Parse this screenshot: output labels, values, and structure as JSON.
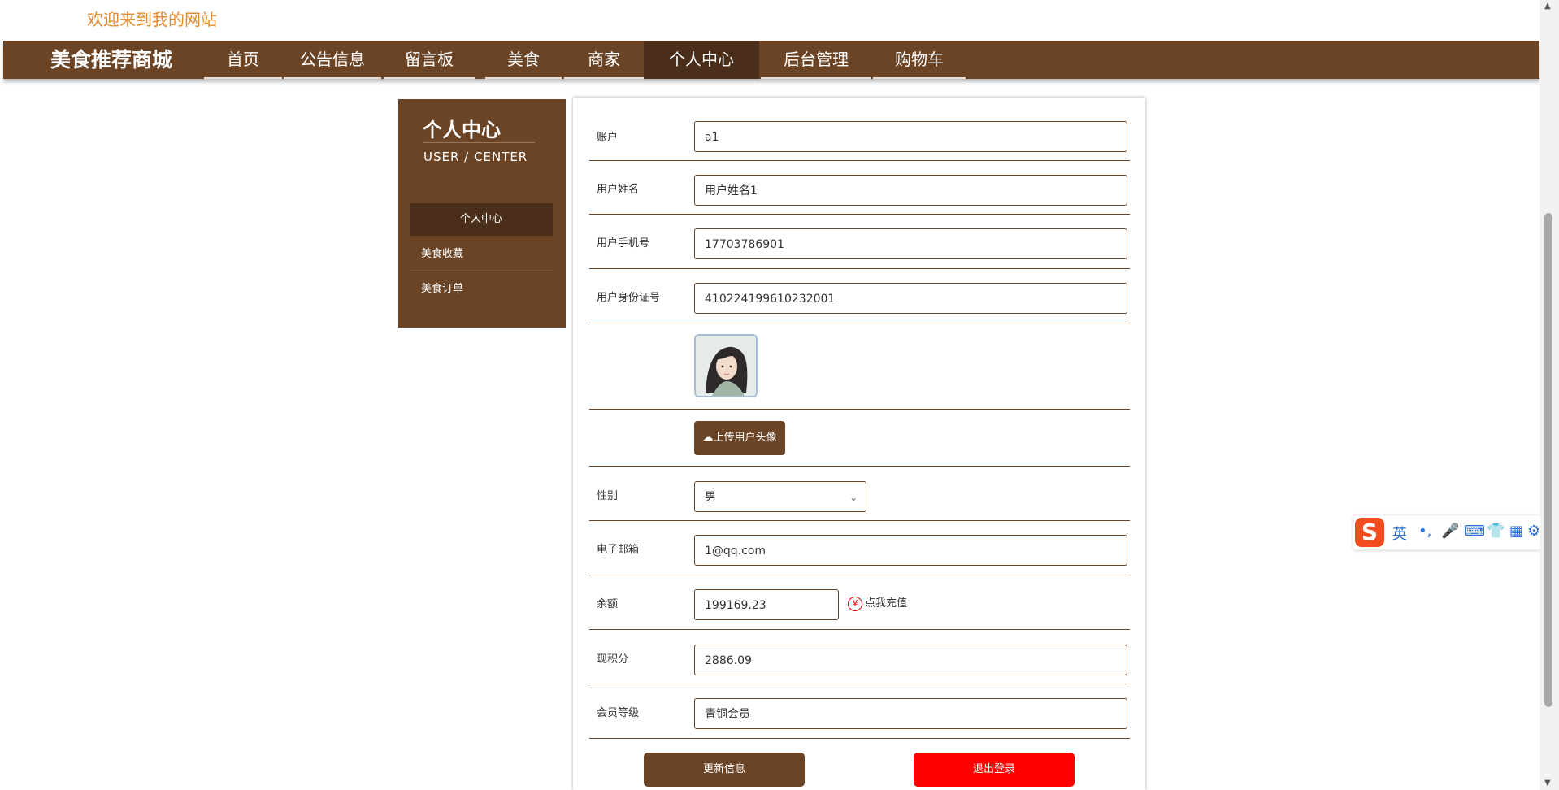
{
  "header": {
    "welcome": "欢迎来到我的网站"
  },
  "navbar": {
    "brand": "美食推荐商城",
    "items": [
      {
        "label": "首页"
      },
      {
        "label": "公告信息"
      },
      {
        "label": "留言板"
      },
      {
        "label": "美食"
      },
      {
        "label": "商家"
      },
      {
        "label": "个人中心",
        "active": true
      },
      {
        "label": "后台管理"
      },
      {
        "label": "购物车"
      }
    ]
  },
  "sidebar": {
    "title": "个人中心",
    "subtitle": "USER / CENTER",
    "items": [
      {
        "label": "个人中心",
        "active": true
      },
      {
        "label": "美食收藏"
      },
      {
        "label": "美食订单"
      }
    ]
  },
  "form": {
    "account_label": "账户",
    "account_value": "a1",
    "name_label": "用户姓名",
    "name_value": "用户姓名1",
    "phone_label": "用户手机号",
    "phone_value": "17703786901",
    "idcard_label": "用户身份证号",
    "idcard_value": "410224199610232001",
    "upload_label": "上传用户头像",
    "gender_label": "性别",
    "gender_value": "男",
    "email_label": "电子邮箱",
    "email_value": "1@qq.com",
    "balance_label": "余额",
    "balance_value": "199169.23",
    "recharge_label": "点我充值",
    "points_label": "现积分",
    "points_value": "2886.09",
    "level_label": "会员等级",
    "level_value": "青铜会员",
    "update_button": "更新信息",
    "logout_button": "退出登录"
  },
  "ime": {
    "mode": "英",
    "logo": "S"
  },
  "colors": {
    "brand": "#6b4426",
    "brand_dark": "#4a2e1a",
    "danger": "#ff0000",
    "welcome": "#e08a2e"
  }
}
